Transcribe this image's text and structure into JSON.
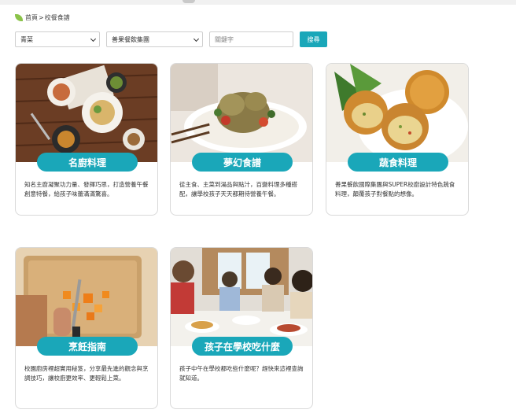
{
  "breadcrumb": {
    "home": "首頁",
    "separator": ">",
    "current": "校餐食譜"
  },
  "filters": {
    "category_value": "青菜",
    "brand_value": "善果餐飲集團",
    "keyword_placeholder": "關鍵字",
    "search_label": "搜尋"
  },
  "cards": [
    {
      "title": "名廚料理",
      "description": "知名主廚凝聚功力量、發揮巧思，打造營養午餐創意特餐，給孩子味蕾滿滿驚喜。"
    },
    {
      "title": "夢幻食譜",
      "description": "從主食、主菜到湯品與點汁，百變料理多種搭配，讓學校孩子天天都期待營養午餐。"
    },
    {
      "title": "蔬食料理",
      "description": "善果餐飲國際集團與SUPER校廚設計特色蔬食料理，顛覆孩子對餐點的想像。"
    },
    {
      "title": "烹飪指南",
      "description": "校園廚房裡超實用秘笈，分享最先進的觀念與烹調技巧，讓校廚更效率、更輕鬆上菜。"
    },
    {
      "title": "孩子在學校吃什麼",
      "description": "孩子中午在學校都吃些什麼呢？趕快來這裡查詢就知道。"
    }
  ]
}
